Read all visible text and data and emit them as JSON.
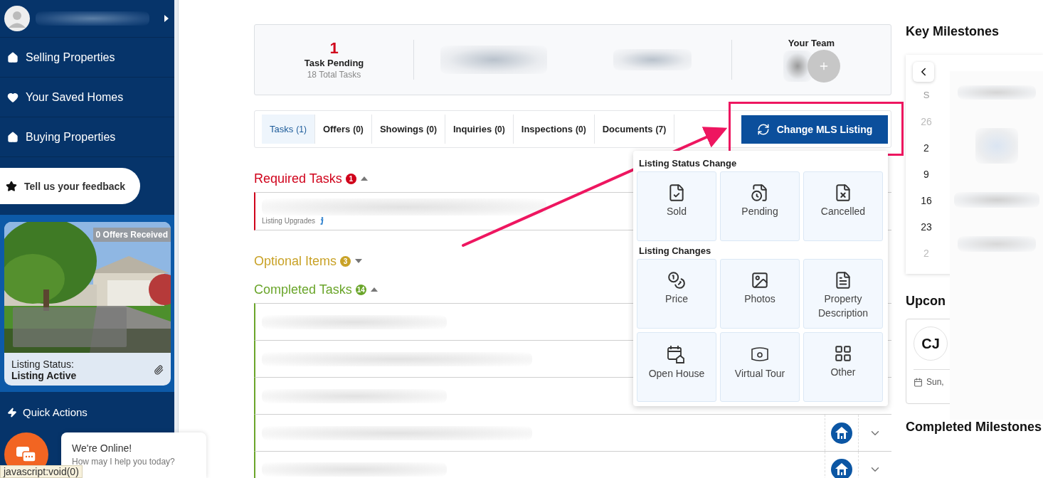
{
  "sidebar": {
    "menu": [
      {
        "label": "Selling Properties",
        "kind": "home"
      },
      {
        "label": "Your Saved Homes",
        "kind": "heart"
      },
      {
        "label": "Buying Properties",
        "kind": "home"
      }
    ],
    "feedback_button": {
      "label": "Tell us your feedback"
    },
    "listing_card": {
      "badge": "0 Offers Received",
      "status_label": "Listing Status:",
      "status_value": "Listing Active"
    },
    "quick_actions": {
      "label": "Quick Actions"
    }
  },
  "summary": {
    "pending_count": "1",
    "pending_label": "Task Pending",
    "total_label": "18 Total Tasks",
    "team_label": "Your Team"
  },
  "tabs": [
    {
      "label": "Tasks",
      "count": "(1)",
      "selected": true
    },
    {
      "label": "Offers",
      "count": "(0)",
      "selected": false
    },
    {
      "label": "Showings",
      "count": "(0)",
      "selected": false
    },
    {
      "label": "Inquiries",
      "count": "(0)",
      "selected": false
    },
    {
      "label": "Inspections",
      "count": "(0)",
      "selected": false
    },
    {
      "label": "Documents",
      "count": "(7)",
      "selected": false
    }
  ],
  "action_button": {
    "label": "Change MLS Listing"
  },
  "sections": [
    {
      "kind": "required",
      "title": "Required Tasks",
      "count": "1",
      "expanded": true,
      "rows": [
        {
          "category": "Listing Upgrades",
          "show_actions": false
        }
      ]
    },
    {
      "kind": "optional",
      "title": "Optional Items",
      "count": "3",
      "expanded": false
    },
    {
      "kind": "completed",
      "title": "Completed Tasks",
      "count": "14",
      "expanded": true,
      "rows": [
        {
          "show_actions": false
        },
        {
          "show_actions": false
        },
        {
          "show_actions": false
        },
        {
          "show_actions": true
        },
        {
          "show_actions": true
        }
      ]
    }
  ],
  "popup": {
    "groups": [
      {
        "title": "Listing Status Change",
        "items": [
          {
            "label": "Sold",
            "kind": "sold"
          },
          {
            "label": "Pending",
            "kind": "pending"
          },
          {
            "label": "Cancelled",
            "kind": "cancelled"
          }
        ]
      },
      {
        "title": "Listing Changes",
        "items": [
          {
            "label": "Price",
            "kind": "price"
          },
          {
            "label": "Photos",
            "kind": "photos"
          },
          {
            "label": "Property Description",
            "kind": "description"
          },
          {
            "label": "Open House",
            "kind": "open-house"
          },
          {
            "label": "Virtual Tour",
            "kind": "virtual-tour"
          },
          {
            "label": "Other",
            "kind": "other"
          }
        ]
      }
    ]
  },
  "milestones": {
    "title": "Key Milestones",
    "weekday": "S",
    "days": [
      {
        "label": "26",
        "outside_month": true
      },
      {
        "label": "2",
        "outside_month": false
      },
      {
        "label": "9",
        "outside_month": false
      },
      {
        "label": "16",
        "outside_month": false
      },
      {
        "label": "23",
        "outside_month": false
      },
      {
        "label": "2",
        "outside_month": true
      }
    ],
    "upcoming_title": "Upcon",
    "upcoming": {
      "initials": "CJ",
      "date": "Sun,"
    },
    "completed_title": "Completed Milestones"
  },
  "chat": {
    "title": "We're Online!",
    "subtitle": "How may I help you today?"
  },
  "status_bar": "javascript:void(0)"
}
